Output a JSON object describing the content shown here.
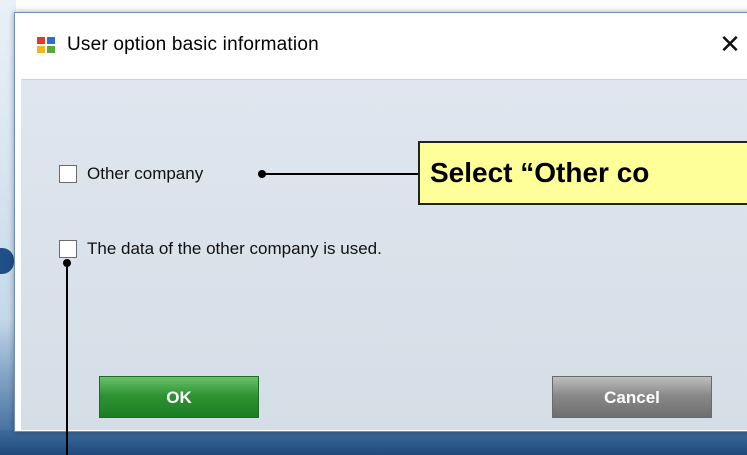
{
  "dialog": {
    "title": "User option basic information",
    "close_glyph": "✕",
    "icon": "app-window-icon"
  },
  "options": [
    {
      "label": "Other company",
      "checked": false
    },
    {
      "label": "The data of the other company is used.",
      "checked": false
    }
  ],
  "buttons": {
    "ok_label": "OK",
    "cancel_label": "Cancel"
  },
  "callout": {
    "text": "Select “Other co"
  },
  "colors": {
    "callout_bg": "#ffff99",
    "ok_green": "#2f9434",
    "cancel_gray": "#8a8a8a"
  }
}
